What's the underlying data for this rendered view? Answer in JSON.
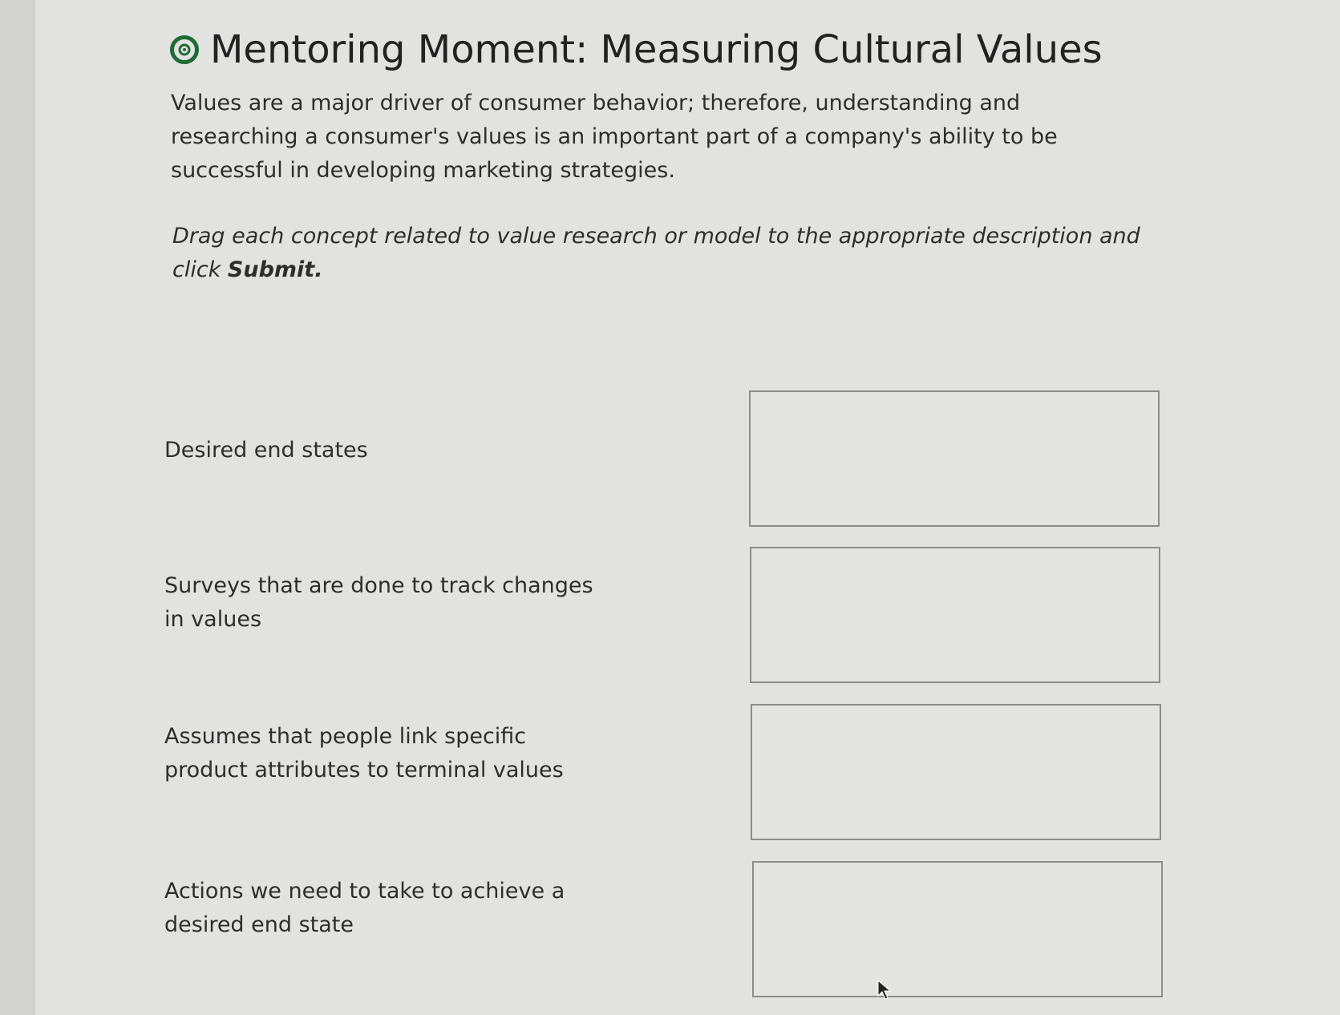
{
  "header": {
    "title": "Mentoring Moment: Measuring Cultural Values",
    "icon": "target-icon",
    "icon_color": "#1f6b35"
  },
  "intro": {
    "text": "Values are a major driver of consumer behavior; therefore, understanding and researching a consumer's values is an important part of a company's ability to be successful in developing marketing strategies."
  },
  "instruction": {
    "text": "Drag each concept related to value research or model to the appropriate description and click ",
    "action": "Submit."
  },
  "rows": [
    {
      "label": "Desired end states"
    },
    {
      "label": "Surveys that are done to track changes in values"
    },
    {
      "label": "Assumes that people link specific product attributes to terminal values"
    },
    {
      "label": "Actions we need to take to achieve a desired end state"
    }
  ]
}
